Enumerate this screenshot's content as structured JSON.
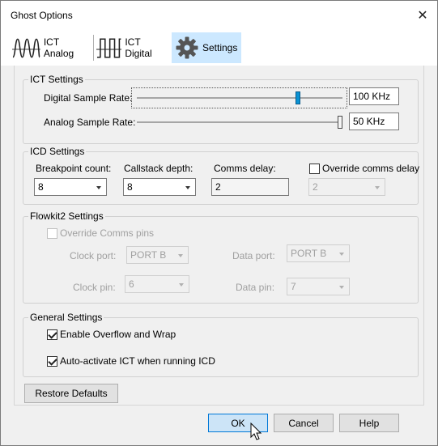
{
  "window": {
    "title": "Ghost Options"
  },
  "tabs": [
    {
      "label": "ICT Analog",
      "icon": "analog-wave-icon"
    },
    {
      "label": "ICT Digital",
      "icon": "digital-wave-icon"
    },
    {
      "label": "Settings",
      "icon": "gear-icon",
      "selected": true
    }
  ],
  "ict_settings": {
    "title": "ICT Settings",
    "digital_label": "Digital Sample Rate:",
    "digital_value": "100 KHz",
    "digital_level": 0.79,
    "analog_label": "Analog Sample Rate:",
    "analog_value": "50 KHz",
    "analog_level": 1.0
  },
  "icd_settings": {
    "title": "ICD Settings",
    "breakpoint_label": "Breakpoint count:",
    "breakpoint_value": "8",
    "callstack_label": "Callstack depth:",
    "callstack_value": "8",
    "comms_delay_label": "Comms delay:",
    "comms_delay_value": "2",
    "override_label": "Override comms delay",
    "override_checked": false,
    "override_value": "2"
  },
  "flowkit2_settings": {
    "title": "Flowkit2 Settings",
    "override_pins_label": "Override Comms pins",
    "clock_port_label": "Clock port:",
    "clock_port_value": "PORT B",
    "data_port_label": "Data port:",
    "data_port_value": "PORT B",
    "clock_pin_label": "Clock pin:",
    "clock_pin_value": "6",
    "data_pin_label": "Data pin:",
    "data_pin_value": "7"
  },
  "general_settings": {
    "title": "General Settings",
    "overflow_label": "Enable Overflow and Wrap",
    "overflow_checked": true,
    "autoactivate_label": "Auto-activate ICT when running ICD",
    "autoactivate_checked": true
  },
  "buttons": {
    "restore": "Restore Defaults",
    "ok": "OK",
    "cancel": "Cancel",
    "help": "Help"
  },
  "colors": {
    "accent": "#0078d7",
    "slider_thumb_active": "#0a93d4",
    "selected_tab": "#cce8ff"
  }
}
